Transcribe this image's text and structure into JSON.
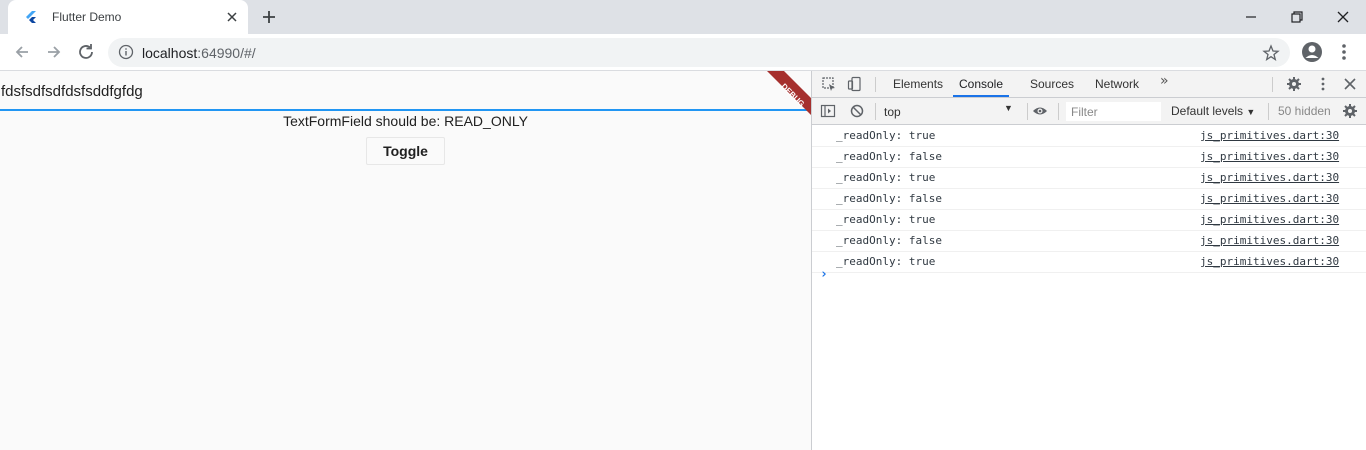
{
  "browser": {
    "tab_title": "Flutter Demo",
    "url_host": "localhost",
    "url_rest": ":64990/#/"
  },
  "app": {
    "text_field_value": "fdsfsdfsdfdsfsddfgfdg",
    "status_text": "TextFormField should be: READ_ONLY",
    "toggle_label": "Toggle",
    "debug_banner": "DEBUG"
  },
  "devtools": {
    "tabs": [
      "Elements",
      "Console",
      "Sources",
      "Network"
    ],
    "active_tab": "Console",
    "context": "top",
    "filter_placeholder": "Filter",
    "levels_label": "Default levels",
    "hidden_label": "50 hidden",
    "logs": [
      {
        "msg": "_readOnly: true",
        "src": "js_primitives.dart:30"
      },
      {
        "msg": "_readOnly: false",
        "src": "js_primitives.dart:30"
      },
      {
        "msg": "_readOnly: true",
        "src": "js_primitives.dart:30"
      },
      {
        "msg": "_readOnly: false",
        "src": "js_primitives.dart:30"
      },
      {
        "msg": "_readOnly: true",
        "src": "js_primitives.dart:30"
      },
      {
        "msg": "_readOnly: false",
        "src": "js_primitives.dart:30"
      },
      {
        "msg": "_readOnly: true",
        "src": "js_primitives.dart:30"
      }
    ]
  },
  "colors": {
    "flutter_blue": "#2196f3",
    "devtools_accent": "#1a73e8",
    "debug_banner": "#a5302e"
  }
}
